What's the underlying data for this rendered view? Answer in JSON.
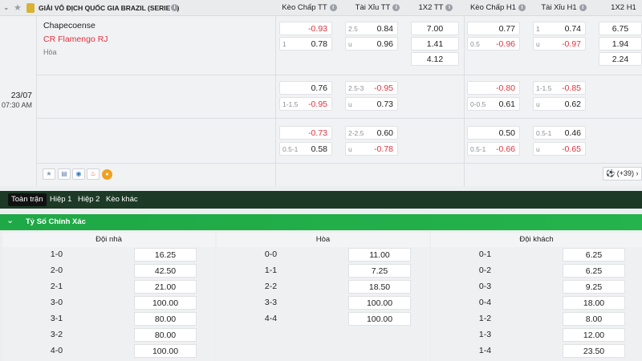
{
  "header": {
    "league": "GIẢI VÔ ĐỊCH QUỐC GIA BRAZIL (SERIE A)",
    "info_glyph": "i",
    "columns": [
      "Kèo Chấp TT",
      "Tài Xỉu TT",
      "1X2 TT",
      "Kèo Chấp H1",
      "Tài Xỉu H1",
      "1X2 H1"
    ]
  },
  "match": {
    "home": "Chapecoense",
    "away": "CR Flamengo RJ",
    "draw": "Hòa",
    "date": "23/07",
    "time": "07:30 AM",
    "more": "(+39)",
    "icons": [
      "star-icon",
      "collapse-chevron-icon",
      "league-logo-icon",
      "info-icon",
      "star-icon",
      "stats-icon",
      "eye-icon",
      "fire-icon",
      "live-icon",
      "ball-icon",
      "chevron-right-icon"
    ]
  },
  "colors": {
    "red": "#e0333f",
    "green": "#1fa846",
    "dark": "#1c3a26"
  },
  "odds_rows": [
    {
      "hc": [
        {
          "h": "",
          "v": "-0.93",
          "c": "red"
        },
        {
          "h": "1",
          "v": "0.78",
          "c": "blk"
        }
      ],
      "ou": [
        {
          "h": "2.5",
          "v": "0.84",
          "c": "blk"
        },
        {
          "h": "u",
          "v": "0.96",
          "c": "blk"
        }
      ],
      "x12": [
        "7.00",
        "1.41",
        "4.12"
      ],
      "hc1": [
        {
          "h": "",
          "v": "0.77",
          "c": "blk"
        },
        {
          "h": "0.5",
          "v": "-0.96",
          "c": "red"
        }
      ],
      "ou1": [
        {
          "h": "1",
          "v": "0.74",
          "c": "blk"
        },
        {
          "h": "u",
          "v": "-0.97",
          "c": "red"
        }
      ],
      "x121": [
        "6.75",
        "1.94",
        "2.24"
      ]
    },
    {
      "hc": [
        {
          "h": "",
          "v": "0.76",
          "c": "blk"
        },
        {
          "h": "1-1.5",
          "v": "-0.95",
          "c": "red"
        }
      ],
      "ou": [
        {
          "h": "2.5-3",
          "v": "-0.95",
          "c": "red"
        },
        {
          "h": "u",
          "v": "0.73",
          "c": "blk"
        }
      ],
      "hc1": [
        {
          "h": "",
          "v": "-0.80",
          "c": "red"
        },
        {
          "h": "0-0.5",
          "v": "0.61",
          "c": "blk"
        }
      ],
      "ou1": [
        {
          "h": "1-1.5",
          "v": "-0.85",
          "c": "red"
        },
        {
          "h": "u",
          "v": "0.62",
          "c": "blk"
        }
      ]
    },
    {
      "hc": [
        {
          "h": "",
          "v": "-0.73",
          "c": "red"
        },
        {
          "h": "0.5-1",
          "v": "0.58",
          "c": "blk"
        }
      ],
      "ou": [
        {
          "h": "2-2.5",
          "v": "0.60",
          "c": "blk"
        },
        {
          "h": "u",
          "v": "-0.78",
          "c": "red"
        }
      ],
      "hc1": [
        {
          "h": "",
          "v": "0.50",
          "c": "blk"
        },
        {
          "h": "0.5-1",
          "v": "-0.66",
          "c": "red"
        }
      ],
      "ou1": [
        {
          "h": "0.5-1",
          "v": "0.46",
          "c": "blk"
        },
        {
          "h": "u",
          "v": "-0.65",
          "c": "red"
        }
      ]
    }
  ],
  "tabs": [
    "Toàn trận",
    "Hiệp 1",
    "Hiệp 2",
    "Kèo khác"
  ],
  "section": {
    "title": "Tỷ Số Chính Xác",
    "chevron": "⌄"
  },
  "correct_score": {
    "headers": [
      "Đội nhà",
      "Hòa",
      "Đội khách"
    ],
    "home": [
      [
        "1-0",
        "16.25"
      ],
      [
        "2-0",
        "42.50"
      ],
      [
        "2-1",
        "21.00"
      ],
      [
        "3-0",
        "100.00"
      ],
      [
        "3-1",
        "80.00"
      ],
      [
        "3-2",
        "80.00"
      ],
      [
        "4-0",
        "100.00"
      ]
    ],
    "draw": [
      [
        "0-0",
        "11.00"
      ],
      [
        "1-1",
        "7.25"
      ],
      [
        "2-2",
        "18.50"
      ],
      [
        "3-3",
        "100.00"
      ],
      [
        "4-4",
        "100.00"
      ]
    ],
    "away": [
      [
        "0-1",
        "6.25"
      ],
      [
        "0-2",
        "6.25"
      ],
      [
        "0-3",
        "9.25"
      ],
      [
        "0-4",
        "18.00"
      ],
      [
        "1-2",
        "8.00"
      ],
      [
        "1-3",
        "12.00"
      ],
      [
        "1-4",
        "23.50"
      ]
    ]
  }
}
